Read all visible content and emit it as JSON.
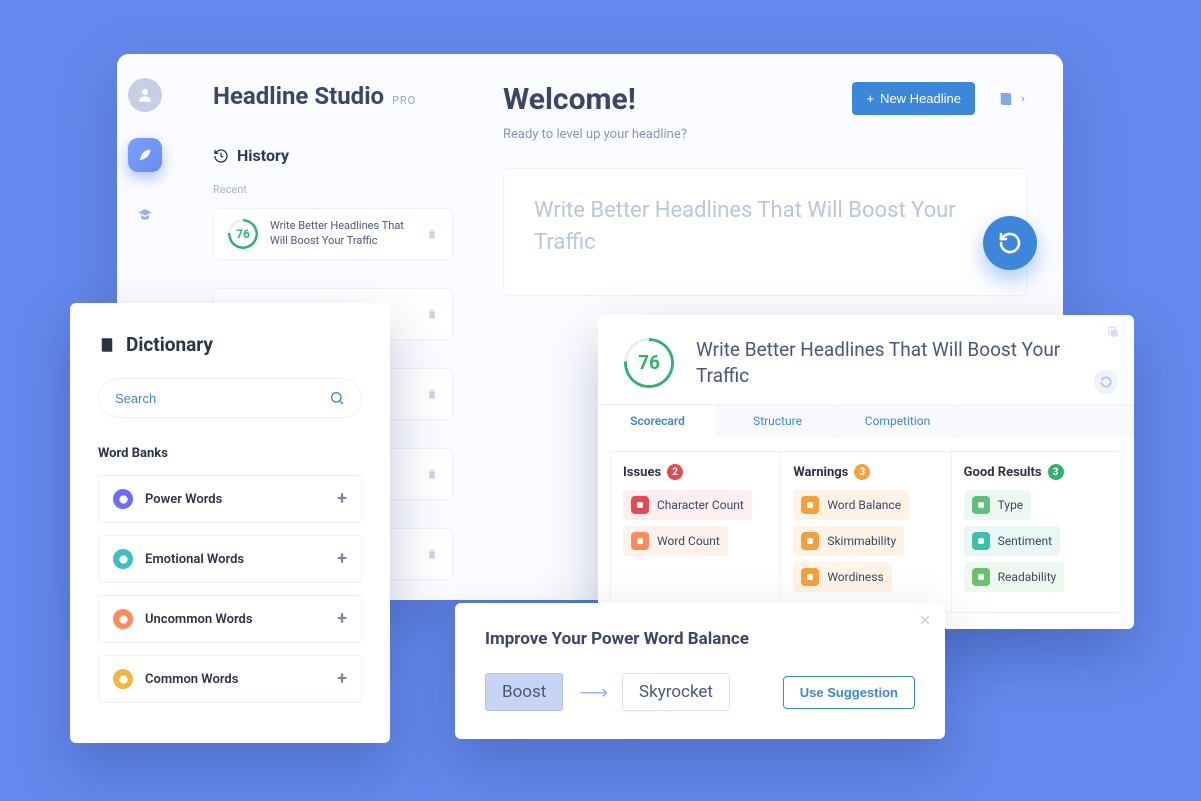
{
  "app": {
    "title": "Headline Studio",
    "plan": "PRO",
    "new_button": "New Headline"
  },
  "history": {
    "heading": "History",
    "recent_label": "Recent",
    "items": [
      {
        "score": "76",
        "text": "Write Better Headlines That Will Boost Your Traffic"
      }
    ]
  },
  "welcome": {
    "title": "Welcome!",
    "subtitle": "Ready to level up your headline?",
    "headline_text": "Write Better Headlines That Will Boost Your Traffic"
  },
  "dictionary": {
    "title": "Dictionary",
    "search_placeholder": "Search",
    "word_banks_heading": "Word Banks",
    "banks": [
      {
        "label": "Power Words",
        "color": "#6b6cff"
      },
      {
        "label": "Emotional Words",
        "color": "#3cc0c0"
      },
      {
        "label": "Uncommon Words",
        "color": "#ff8a5c"
      },
      {
        "label": "Common Words",
        "color": "#f4b63f"
      }
    ]
  },
  "scorecard": {
    "score": "76",
    "headline": "Write Better Headlines That Will Boost Your Traffic",
    "tabs": [
      "Scorecard",
      "Structure",
      "Competition"
    ],
    "columns": {
      "issues": {
        "title": "Issues",
        "count": "2",
        "badge_color": "#e24b55",
        "chips": [
          {
            "label": "Character Count",
            "color": "#e24b55",
            "bg": "#fdeef0"
          },
          {
            "label": "Word Count",
            "color": "#ff8a5c",
            "bg": "#fef2ec"
          }
        ]
      },
      "warnings": {
        "title": "Warnings",
        "count": "3",
        "badge_color": "#f1a33c",
        "chips": [
          {
            "label": "Word Balance",
            "color": "#f4a13a",
            "bg": "#fff3e5"
          },
          {
            "label": "Skimmability",
            "color": "#f4a13a",
            "bg": "#fff3e5"
          },
          {
            "label": "Wordiness",
            "color": "#f4a13a",
            "bg": "#fff3e5"
          }
        ]
      },
      "good": {
        "title": "Good Results",
        "count": "3",
        "badge_color": "#2fb36a",
        "chips": [
          {
            "label": "Type",
            "color": "#5fbf7d",
            "bg": "#ecf8f1"
          },
          {
            "label": "Sentiment",
            "color": "#3cc0a8",
            "bg": "#eaf8f5"
          },
          {
            "label": "Readability",
            "color": "#6bc06b",
            "bg": "#eef8ee"
          }
        ]
      }
    }
  },
  "suggestion": {
    "title": "Improve Your Power Word Balance",
    "from": "Boost",
    "to": "Skyrocket",
    "button": "Use Suggestion"
  }
}
